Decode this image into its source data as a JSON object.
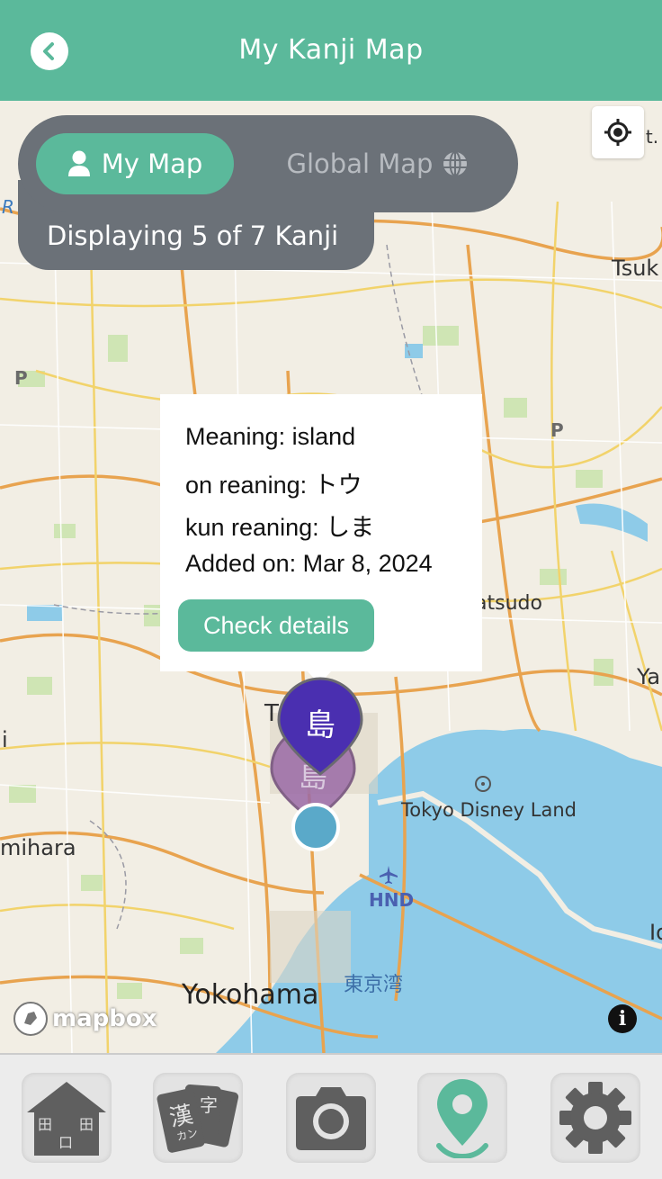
{
  "header": {
    "title": "My Kanji Map"
  },
  "toggle": {
    "my_map_label": "My Map",
    "global_map_label": "Global Map",
    "display_text": "Displaying 5 of 7 Kanji"
  },
  "map": {
    "labels": {
      "tsuk": "Tsuk",
      "matsudo": "atsudo",
      "ya": "Ya",
      "tokyo_disney": "Tokyo Disney Land",
      "hnd": "HND",
      "tokyo_bay": "東京湾",
      "yokohama": "Yokohama",
      "sagamihara": "mihara",
      "p1": "P",
      "p2": "P",
      "it": "It.",
      "t": "T",
      "i": "i",
      "io": "Io",
      "r": "R"
    },
    "attribution": "mapbox"
  },
  "popup": {
    "meaning": "Meaning: island",
    "on_reading": "on reaning: トウ",
    "kun_reading": "kun reaning: しま",
    "added_on": "Added on: Mar 8, 2024",
    "button_label": "Check details"
  },
  "pins": {
    "active_kanji": "島",
    "secondary_kanji": "島",
    "active_color": "#4a2fb0",
    "secondary_color": "#9b6aa6",
    "location_color": "#5aa9c9"
  },
  "bottom_nav": {
    "items": [
      {
        "name": "home",
        "icon": "house-icon",
        "glyph_left": "田",
        "glyph_right": "田",
        "glyph_bottom": "口"
      },
      {
        "name": "cards",
        "icon": "kanji-cards-icon",
        "glyph_1": "漢",
        "glyph_2": "字",
        "glyph_3": "カン"
      },
      {
        "name": "camera",
        "icon": "camera-icon"
      },
      {
        "name": "map",
        "icon": "map-pin-icon",
        "active": true
      },
      {
        "name": "settings",
        "icon": "gear-icon"
      }
    ],
    "active_color": "#5bb99b",
    "inactive_color": "#5f5f5f"
  }
}
